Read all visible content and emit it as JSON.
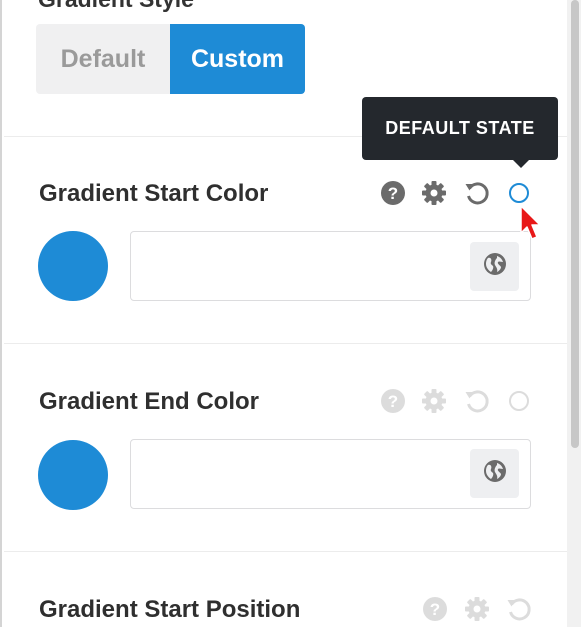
{
  "section_header": {
    "label": "Gradient Style"
  },
  "toggle": {
    "default_label": "Default",
    "custom_label": "Custom",
    "selected": "Custom"
  },
  "tooltip": {
    "text": "DEFAULT STATE"
  },
  "fields": {
    "start_color": {
      "label": "Gradient Start Color",
      "value": "",
      "swatch_color": "#1e8bd6"
    },
    "end_color": {
      "label": "Gradient End Color",
      "value": "",
      "swatch_color": "#1e8bd6"
    },
    "start_position": {
      "label": "Gradient Start Position"
    }
  },
  "icons": {
    "help": "help-icon",
    "settings": "gear-icon",
    "reset": "reset-icon",
    "state": "state-circle-icon",
    "global": "globe-icon",
    "cursor": "mouse-pointer-icon"
  },
  "colors": {
    "accent": "#1e8bd6",
    "icon_active": "#6b6b6b",
    "icon_inactive": "#dcdcdc",
    "tooltip_bg": "#24282d"
  }
}
